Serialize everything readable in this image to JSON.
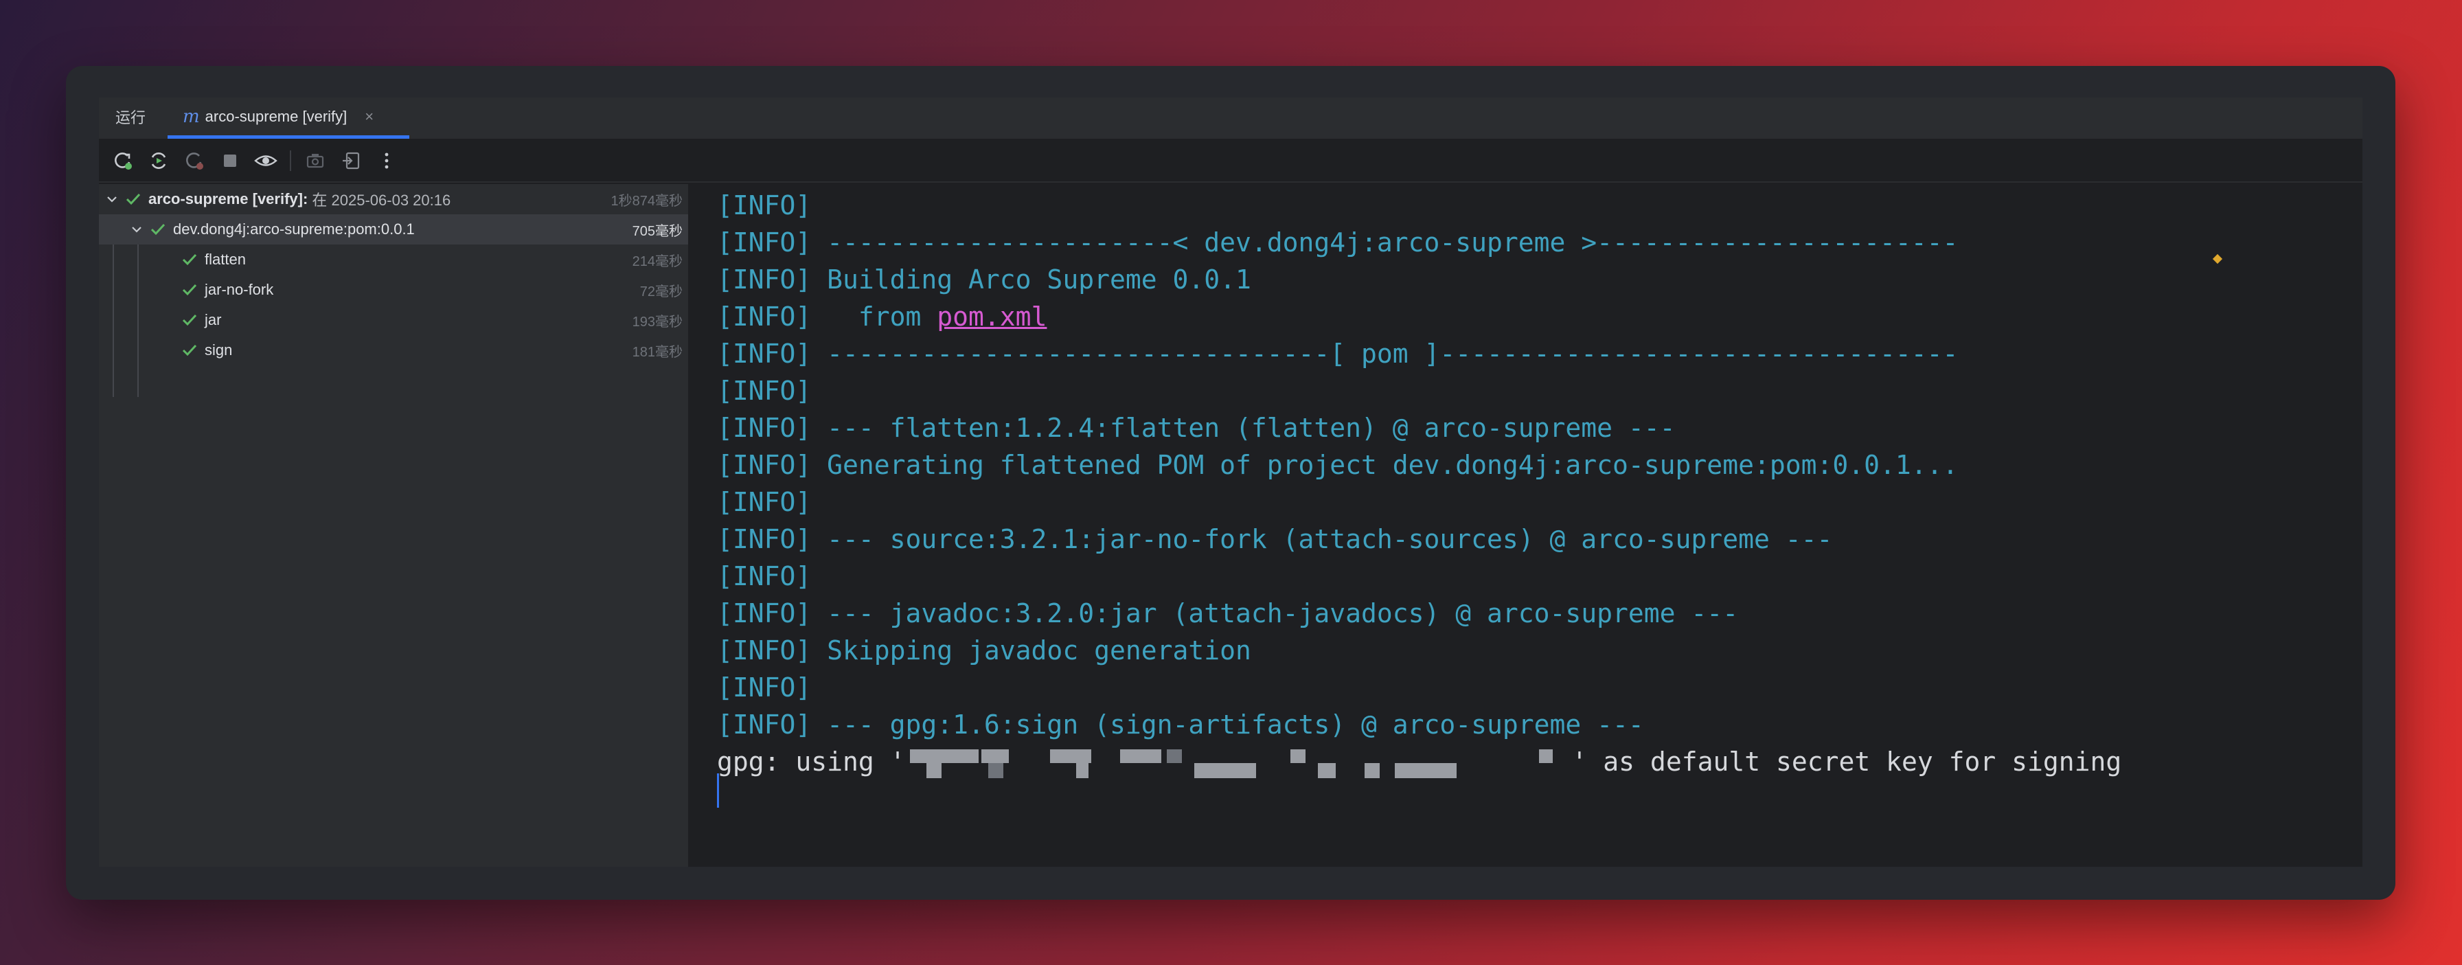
{
  "tabs": {
    "run_label": "运行",
    "active_tab": {
      "icon": "maven-icon",
      "label": "arco-supreme [verify]"
    }
  },
  "toolbar": {
    "buttons": [
      "rerun-icon",
      "rerun-failed-icon",
      "toggle-auto-rerun-icon",
      "stop-icon",
      "show-icon",
      "screenshot-icon",
      "import-icon",
      "more-icon"
    ]
  },
  "tree": {
    "root": {
      "label_bold": "arco-supreme [verify]:",
      "label_rest": " 在 2025-06-03 20:16",
      "duration": "1秒874毫秒"
    },
    "module": {
      "label": "dev.dong4j:arco-supreme:pom:0.0.1",
      "duration": "705毫秒"
    },
    "goals": [
      {
        "label": "flatten",
        "duration": "214毫秒"
      },
      {
        "label": "jar-no-fork",
        "duration": "72毫秒"
      },
      {
        "label": "jar",
        "duration": "193毫秒"
      },
      {
        "label": "sign",
        "duration": "181毫秒"
      }
    ]
  },
  "console": {
    "lines": [
      "[INFO]",
      "[INFO] ----------------------< dev.dong4j:arco-supreme >-----------------------",
      "[INFO] Building Arco Supreme 0.0.1",
      "[INFO]",
      "[INFO] --------------------------------[ pom ]---------------------------------",
      "[INFO]",
      "[INFO] --- flatten:1.2.4:flatten (flatten) @ arco-supreme ---",
      "[INFO] Generating flattened POM of project dev.dong4j:arco-supreme:pom:0.0.1...",
      "[INFO]",
      "[INFO] --- source:3.2.1:jar-no-fork (attach-sources) @ arco-supreme ---",
      "[INFO]",
      "[INFO] --- javadoc:3.2.0:jar (attach-javadocs) @ arco-supreme ---",
      "[INFO] Skipping javadoc generation",
      "[INFO]",
      "[INFO] --- gpg:1.6:sign (sign-artifacts) @ arco-supreme ---"
    ],
    "from_prefix": "[INFO]   from ",
    "from_link": "pom.xml",
    "gpg_prefix": "gpg: using '",
    "gpg_suffix": "' as default secret key for signing"
  },
  "colors": {
    "info": "#3fa2c0",
    "link": "#d65ad1",
    "success": "#5fb865",
    "accent": "#3574f0"
  }
}
